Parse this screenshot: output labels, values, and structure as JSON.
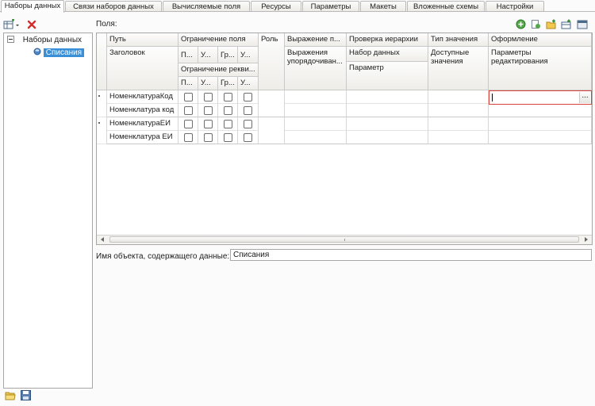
{
  "tabs": [
    {
      "label": "Наборы данных",
      "active": true
    },
    {
      "label": "Связи наборов данных",
      "active": false
    },
    {
      "label": "Вычисляемые поля",
      "active": false
    },
    {
      "label": "Ресурсы",
      "active": false
    },
    {
      "label": "Параметры",
      "active": false
    },
    {
      "label": "Макеты",
      "active": false
    },
    {
      "label": "Вложенные схемы",
      "active": false
    },
    {
      "label": "Настройки",
      "active": false
    }
  ],
  "left_panel": {
    "toolbar": [
      {
        "icon": "add-dataset-dropdown-icon"
      },
      {
        "icon": "delete-icon"
      }
    ],
    "tree": {
      "root_label": "Наборы данных",
      "child_label": "Списания"
    }
  },
  "fields_panel": {
    "label": "Поля:",
    "toolbar_icons": [
      "add-circle-icon",
      "add-field-icon",
      "add-folder-icon",
      "add-row-icon",
      "settings-icon"
    ],
    "headers": {
      "path": "Путь",
      "title": "Заголовок",
      "field_restriction": "Ограничение поля",
      "fr_sub": [
        "П...",
        "У...",
        "Гр...",
        "У..."
      ],
      "attr_restriction": "Ограничение рекви...",
      "ar_sub": [
        "П...",
        "У...",
        "Гр...",
        "У..."
      ],
      "role": "Роль",
      "expression": "Выражение п...",
      "expression_sub": "Выражения упорядочиван...",
      "hierarchy_check": "Проверка иерархии",
      "dataset": "Набор данных",
      "parameter": "Параметр",
      "value_type": "Тип значения",
      "available_values": "Доступные значения",
      "appearance": "Оформление",
      "edit_params": "Параметры редактирования"
    },
    "rows": [
      {
        "path": "НоменклатураКод",
        "title": "Номенклатура код"
      },
      {
        "path": "НоменклатураЕИ",
        "title": "Номенклатура ЕИ"
      }
    ],
    "edit_button_label": "..."
  },
  "object_name": {
    "label": "Имя объекта, содержащего данные:",
    "value": "Списания"
  }
}
